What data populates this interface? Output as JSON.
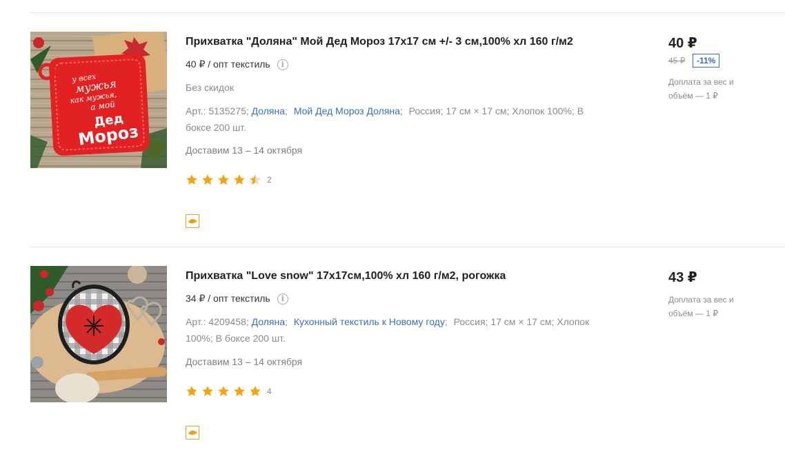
{
  "products": [
    {
      "title": "Прихватка \"Доляна\" Мой Дед Мороз 17х17 см +/- 3 см,100% хл 160 г/м2",
      "wholesale": "40 ₽ / опт текстиль",
      "no_discount": "Без скидок",
      "article": "Арт.: 5135275;",
      "brand": "Доляна",
      "series": "Мой Дед Мороз Доляна",
      "country": "Россия;",
      "size": "17 см × 17 см;",
      "material": "Хлопок 100%;",
      "box": "В боксе 200 шт.",
      "delivery": "Доставим 13 – 14 октября",
      "rating": 4.5,
      "rating_count": "2",
      "price": "40 ₽",
      "old_price": "45 ₽",
      "discount": "-11%",
      "surcharge": "Доплата за вес и объём — 1 ₽",
      "image_text": [
        "у всех",
        "мужья",
        "как мужья,",
        "а мой",
        "Дед",
        "Мороз"
      ]
    },
    {
      "title": "Прихватка \"Love snow\" 17х17см,100% хл 160 г/м2, рогожка",
      "wholesale": "34 ₽ / опт текстиль",
      "article": "Арт.: 4209458;",
      "brand": "Доляна",
      "series": "Кухонный текстиль к Новому году",
      "country": "Россия;",
      "size": "17 см × 17 см;",
      "material": "Хлопок 100%;",
      "box": "В боксе 200 шт.",
      "delivery": "Доставим 13 – 14 октября",
      "rating": 5,
      "rating_count": "4",
      "price": "43 ₽",
      "surcharge": "Доплата за вес и объём — 1 ₽"
    }
  ],
  "colors": {
    "link": "#3a6fb0",
    "star": "#f5a50a",
    "badge": "#3d63c4",
    "partner": "#e4a21c"
  },
  "icons": {
    "info": "info-icon",
    "star": "star-icon",
    "partner": "partner-fish-icon"
  }
}
